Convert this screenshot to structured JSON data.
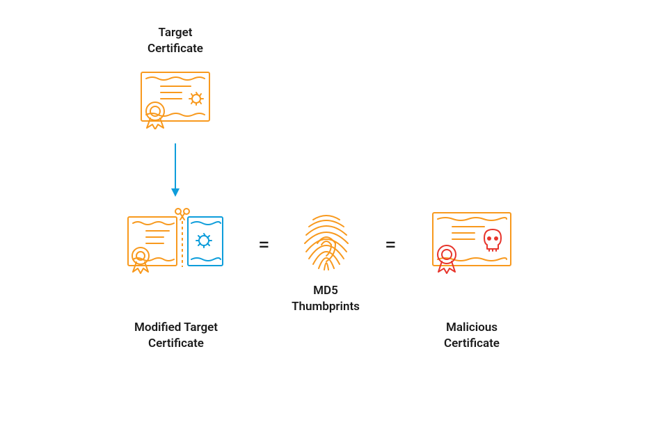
{
  "labels": {
    "target": "Target\nCertificate",
    "modified": "Modified Target\nCertificate",
    "md5": "MD5\nThumbprints",
    "malicious": "Malicious\nCertificate"
  },
  "symbols": {
    "equals1": "=",
    "equals2": "="
  },
  "icons": {
    "target_cert": "certificate-icon",
    "modified_cert": "modified-certificate-icon",
    "fingerprint": "fingerprint-icon",
    "malicious_cert": "malicious-certificate-icon",
    "arrow": "arrow-down-icon",
    "scissors": "scissors-icon",
    "skull": "skull-icon"
  },
  "colors": {
    "orange": "#f8991d",
    "blue": "#0d9ddb",
    "red": "#e7352c",
    "text": "#1a1a1a"
  }
}
